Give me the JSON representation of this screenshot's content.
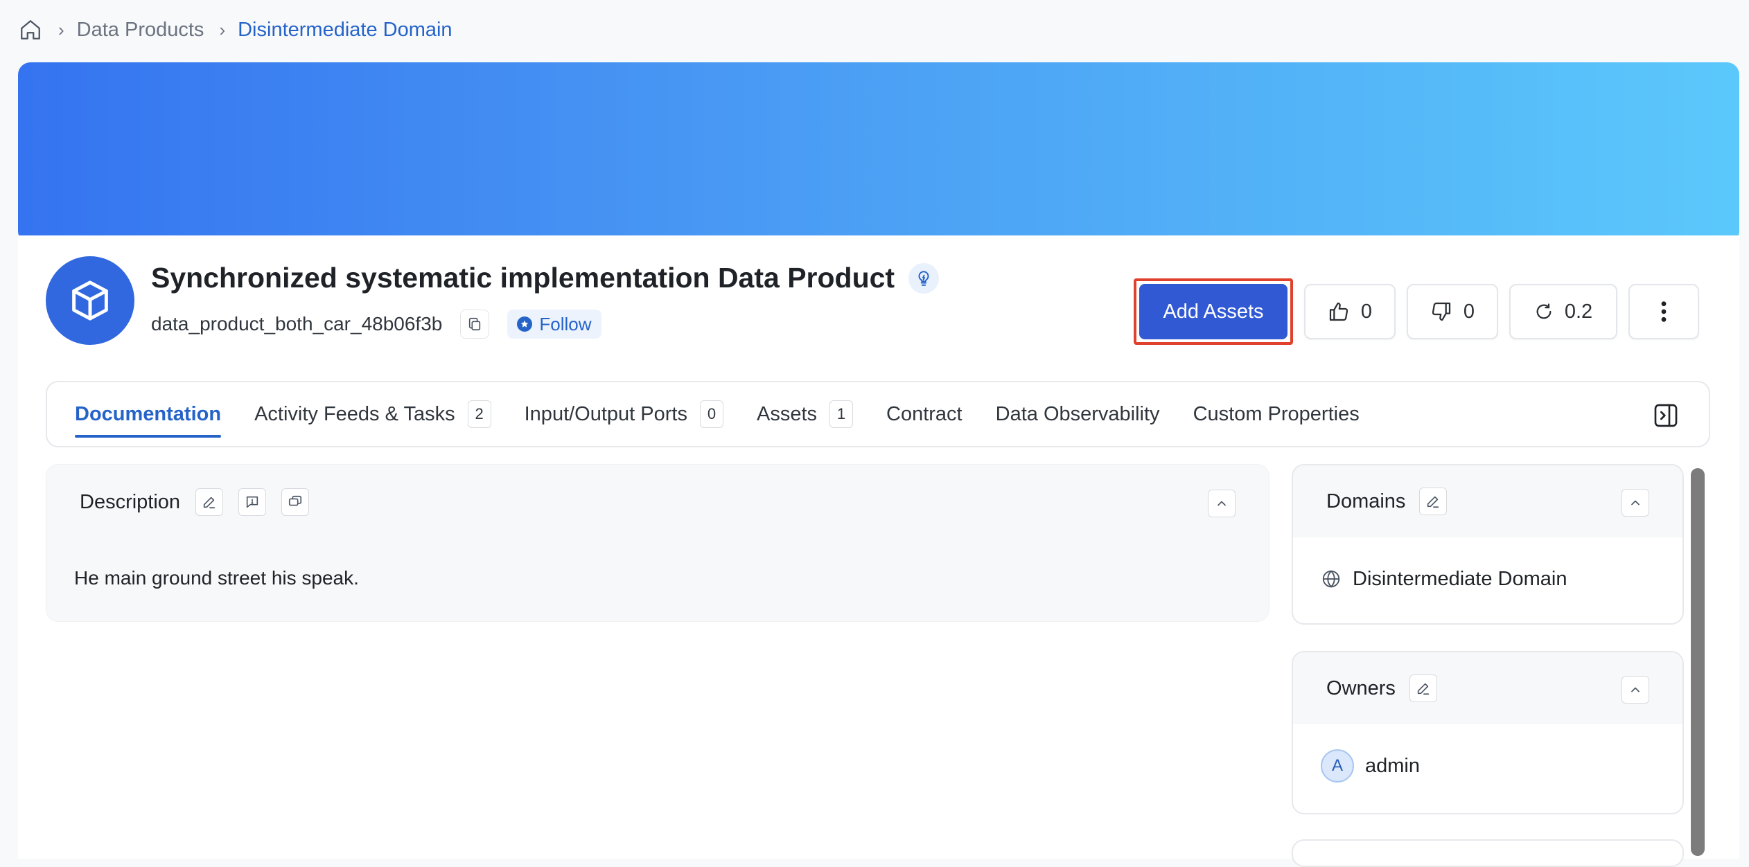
{
  "breadcrumb": {
    "items": [
      "Data Products",
      "Disintermediate Domain"
    ]
  },
  "header": {
    "title": "Synchronized systematic implementation Data Product",
    "fqn": "data_product_both_car_48b06f3b",
    "follow_label": "Follow"
  },
  "actions": {
    "add_assets_label": "Add Assets",
    "likes": "0",
    "dislikes": "0",
    "version": "0.2"
  },
  "tabs": [
    {
      "label": "Documentation",
      "count": null
    },
    {
      "label": "Activity Feeds & Tasks",
      "count": "2"
    },
    {
      "label": "Input/Output Ports",
      "count": "0"
    },
    {
      "label": "Assets",
      "count": "1"
    },
    {
      "label": "Contract",
      "count": null
    },
    {
      "label": "Data Observability",
      "count": null
    },
    {
      "label": "Custom Properties",
      "count": null
    }
  ],
  "description": {
    "heading": "Description",
    "text": "He main ground street his speak."
  },
  "domains": {
    "heading": "Domains",
    "value": "Disintermediate Domain"
  },
  "owners": {
    "heading": "Owners",
    "avatar_letter": "A",
    "value": "admin"
  },
  "colors": {
    "accent": "#2563c9",
    "primary_button": "#3159d4",
    "highlight_border": "#e0412d",
    "banner_start": "#3573f0",
    "banner_end": "#5bc8fb"
  }
}
